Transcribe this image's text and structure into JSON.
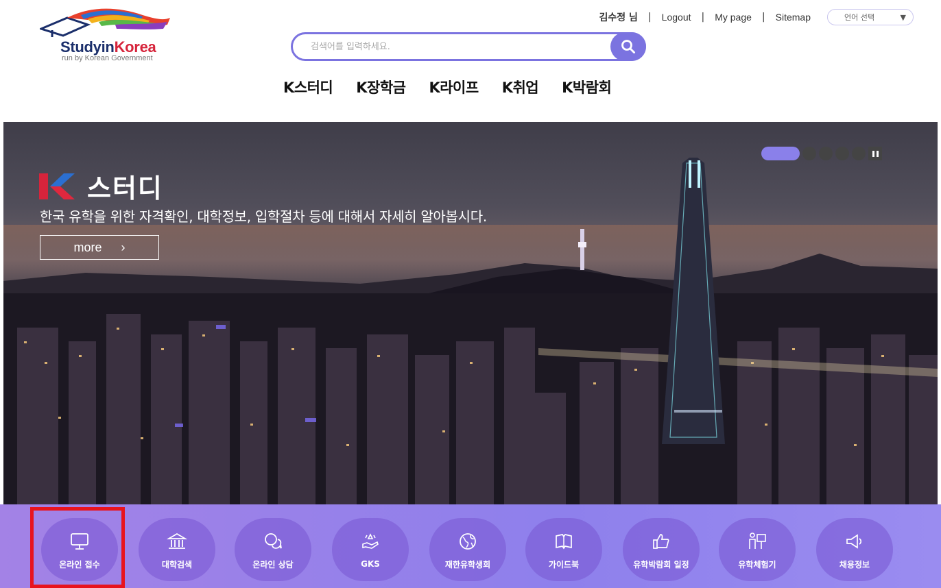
{
  "logo": {
    "brand_part1": "Studyin",
    "brand_part2": "Korea",
    "subtitle": "run by Korean Government"
  },
  "util": {
    "user": "김수정 님",
    "logout": "Logout",
    "mypage": "My page",
    "sitemap": "Sitemap",
    "language": "언어 선택"
  },
  "search": {
    "placeholder": "검색어를 입력하세요."
  },
  "gnb": [
    "K스터디",
    "K장학금",
    "K라이프",
    "K취업",
    "K박람회"
  ],
  "hero": {
    "title": "스터디",
    "description": "한국 유학을 위한 자격확인, 대학정보, 입학절차 등에 대해서 자세히 알아봅시다.",
    "more": "more",
    "more_arrow": "›",
    "slides_total": 5,
    "slide_active": 1
  },
  "quick_menu": [
    {
      "label": "온라인 접수",
      "icon": "monitor-icon"
    },
    {
      "label": "대학검색",
      "icon": "university-icon"
    },
    {
      "label": "온라인 상담",
      "icon": "chat-icon"
    },
    {
      "label": "GKS",
      "icon": "scholarship-hand-icon"
    },
    {
      "label": "재한유학생회",
      "icon": "globe-icon"
    },
    {
      "label": "가이드북",
      "icon": "book-icon"
    },
    {
      "label": "유학박람회 일정",
      "icon": "thumbs-up-icon"
    },
    {
      "label": "유학체험기",
      "icon": "presenter-icon"
    },
    {
      "label": "채용정보",
      "icon": "megaphone-icon"
    }
  ],
  "colors": {
    "accent": "#7b73e0",
    "highlight": "#e8141e",
    "brand_navy": "#1b2f6b",
    "brand_red": "#d6243b"
  }
}
